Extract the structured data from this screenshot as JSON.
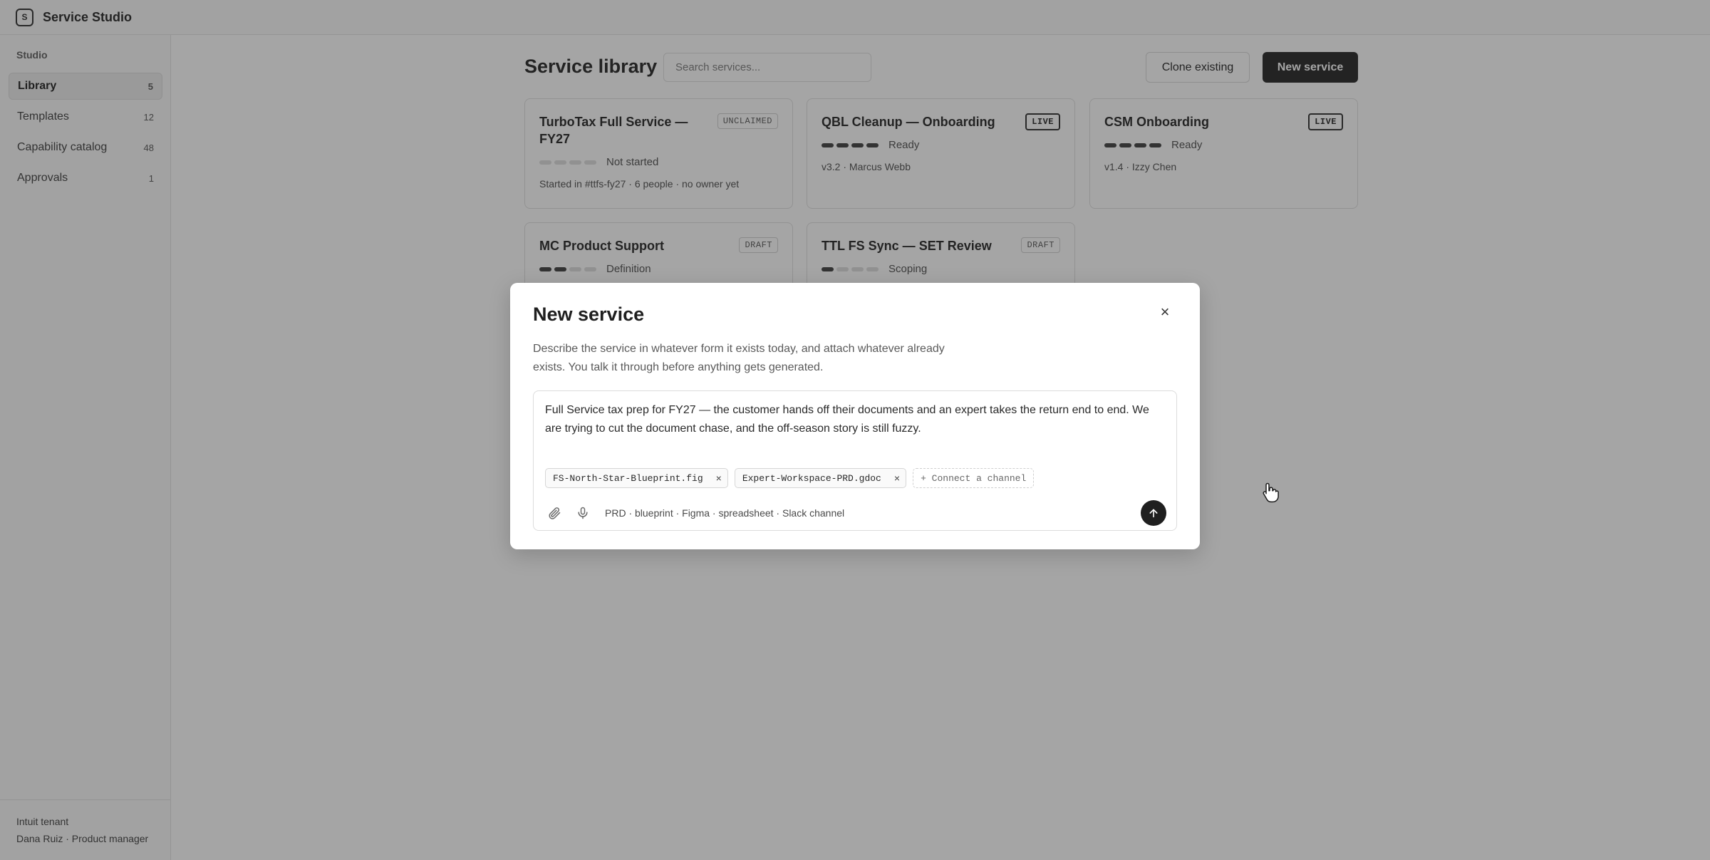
{
  "app": {
    "logo_letter": "S",
    "title": "Service Studio"
  },
  "sidebar": {
    "section_label": "Studio",
    "items": [
      {
        "label": "Library",
        "count": "5",
        "active": true
      },
      {
        "label": "Templates",
        "count": "12",
        "active": false
      },
      {
        "label": "Capability catalog",
        "count": "48",
        "active": false
      },
      {
        "label": "Approvals",
        "count": "1",
        "active": false
      }
    ],
    "footer": {
      "tenant": "Intuit tenant",
      "user": "Dana Ruiz · Product manager"
    }
  },
  "library": {
    "title": "Service library",
    "search_placeholder": "Search services...",
    "clone_label": "Clone existing",
    "new_label": "New service",
    "cards": [
      {
        "title": "TurboTax Full Service — FY27",
        "badge": "UNCLAIMED",
        "progress": 0,
        "stage": "Not started",
        "meta": "Started in #ttfs-fy27 · 6 people · no owner yet"
      },
      {
        "title": "QBL Cleanup — Onboarding",
        "badge": "LIVE",
        "progress": 4,
        "stage": "Ready",
        "meta": "v3.2 · Marcus Webb"
      },
      {
        "title": "CSM Onboarding",
        "badge": "LIVE",
        "progress": 4,
        "stage": "Ready",
        "meta": "v1.4 · Izzy Chen"
      },
      {
        "title": "MC Product Support",
        "badge": "DRAFT",
        "progress": 2,
        "stage": "Definition",
        "meta": ""
      },
      {
        "title": "TTL FS Sync — SET Review",
        "badge": "DRAFT",
        "progress": 1,
        "stage": "Scoping",
        "meta": ""
      }
    ]
  },
  "modal": {
    "title": "New service",
    "close_glyph": "×",
    "description": "Describe the service in whatever form it exists today, and attach whatever already exists. You talk it through before anything gets generated.",
    "composer_text": "Full Service tax prep for FY27 — the customer hands off their documents and an expert takes the return end to end. We are trying to cut the document chase, and the off-season story is still fuzzy.",
    "attachments": [
      {
        "name": "FS-North-Star-Blueprint.fig",
        "remove": "×"
      },
      {
        "name": "Expert-Workspace-PRD.gdoc",
        "remove": "×"
      }
    ],
    "connect_label": "+ Connect a channel",
    "formats": "PRD · blueprint · Figma · spreadsheet · Slack channel"
  },
  "icons": {
    "attach": "paperclip-icon",
    "mic": "microphone-icon",
    "send": "arrow-up-icon",
    "cursor": "hand-pointer-icon"
  }
}
